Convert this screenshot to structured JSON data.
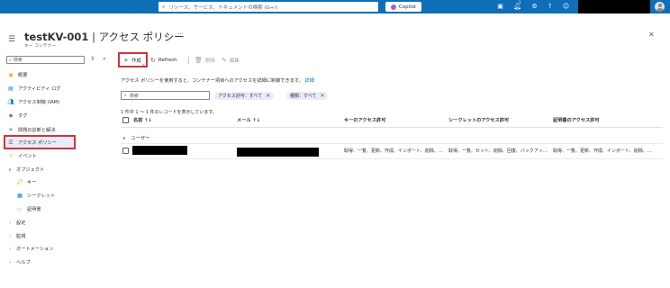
{
  "topbar": {
    "search_placeholder": "リソース、サービス、ドキュメントの検索 (G+/)",
    "copilot_label": "Copilot",
    "icons": [
      "cloud-shell-icon",
      "bell-icon",
      "gear-icon",
      "help-icon",
      "feedback-icon"
    ],
    "notification_count": "1"
  },
  "header": {
    "resource_name": "testKV-001",
    "page_name": "| アクセス ポリシー",
    "subtitle": "キー コンテナー",
    "star": "☆",
    "more": "···",
    "close": "✕"
  },
  "sidebar": {
    "search_placeholder": "検索",
    "items": [
      {
        "label": "概要",
        "icon": "overview-icon"
      },
      {
        "label": "アクティビティ ログ",
        "icon": "activity-log-icon"
      },
      {
        "label": "アクセス制御 (IAM)",
        "icon": "iam-icon"
      },
      {
        "label": "タグ",
        "icon": "tag-icon"
      },
      {
        "label": "問題の診断と解決",
        "icon": "diagnose-icon"
      },
      {
        "label": "アクセス ポリシー",
        "icon": "access-policy-icon",
        "selected": true
      },
      {
        "label": "イベント",
        "icon": "events-icon"
      },
      {
        "label": "オブジェクト",
        "icon": "chevron-down-icon",
        "expanded": true
      },
      {
        "label": "キー",
        "icon": "key-icon"
      },
      {
        "label": "シークレット",
        "icon": "secret-icon"
      },
      {
        "label": "証明書",
        "icon": "certificate-icon"
      },
      {
        "label": "設定",
        "icon": "chevron-right-icon"
      },
      {
        "label": "監視",
        "icon": "chevron-right-icon"
      },
      {
        "label": "オートメーション",
        "icon": "chevron-right-icon"
      },
      {
        "label": "ヘルプ",
        "icon": "chevron-right-icon"
      }
    ]
  },
  "toolbar": {
    "create_label": "作成",
    "refresh_label": "Refresh",
    "delete_label": "削除",
    "edit_label": "編集"
  },
  "description": {
    "text": "アクセス ポリシーを使用すると、コンテナー項目へのアクセスを詳細に制御できます。",
    "link": "詳細"
  },
  "filters": {
    "search_placeholder": "検索",
    "pill1": "アクセス許可：すべて",
    "pill2": "種類：すべて"
  },
  "table": {
    "count_text": "1 件中 1 ～ 1 件のレコードを表示しています。",
    "columns": [
      "名前 ↑↓",
      "メール ↑↓",
      "キーのアクセス許可",
      "シークレットのアクセス許可",
      "証明書のアクセス許可"
    ],
    "group_label": "ユーザー",
    "rows": [
      {
        "key_permissions": "取得、一覧、更新、作成、インポート、削除、…",
        "secret_permissions": "取得、一覧、セット、削除、回復、バックアッ…",
        "cert_permissions": "取得、一覧、更新、作成、インポート、削除、…"
      }
    ]
  }
}
